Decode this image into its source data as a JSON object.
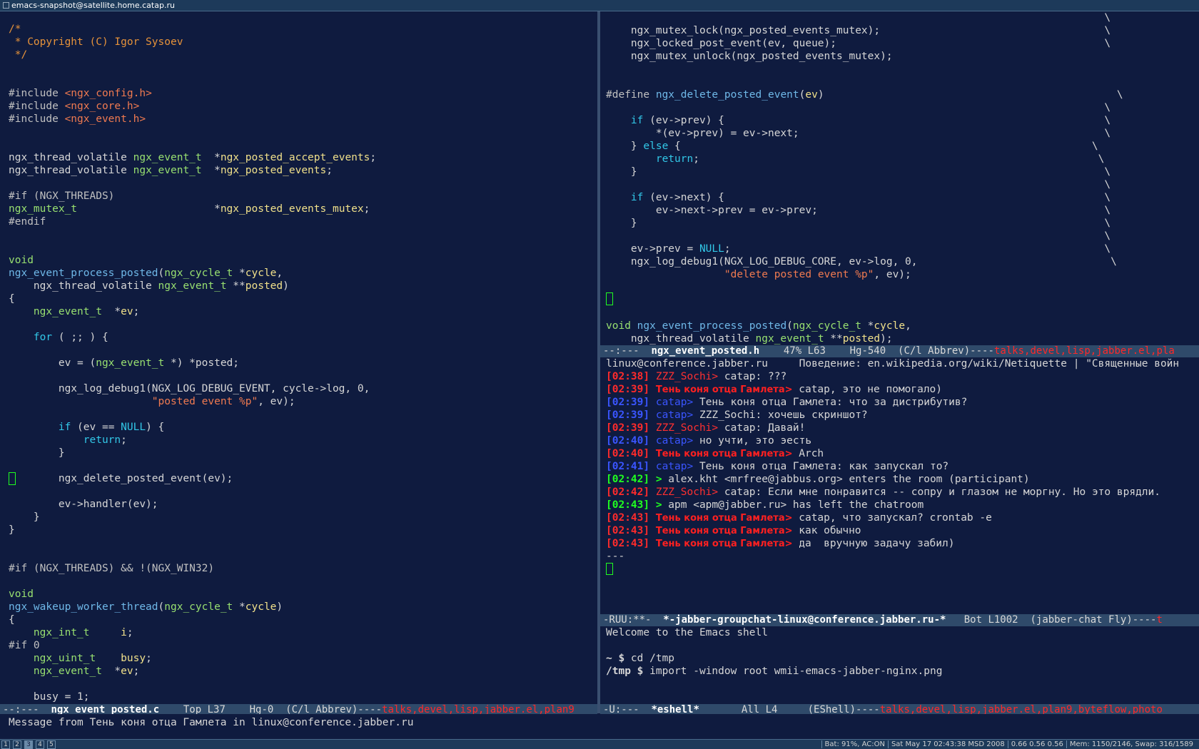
{
  "window_title": "emacs-snapshot@satellite.home.catap.ru",
  "left_buffer": {
    "lines": [
      [
        {
          "t": "/*",
          "c": "comment"
        }
      ],
      [
        {
          "t": " * Copyright (C) Igor Sysoev",
          "c": "comment"
        }
      ],
      [
        {
          "t": " */",
          "c": "comment"
        }
      ],
      [],
      [],
      [
        {
          "t": "#include ",
          "c": "def"
        },
        {
          "t": "<ngx_config.h>",
          "c": "str"
        }
      ],
      [
        {
          "t": "#include ",
          "c": "def"
        },
        {
          "t": "<ngx_core.h>",
          "c": "str"
        }
      ],
      [
        {
          "t": "#include ",
          "c": "def"
        },
        {
          "t": "<ngx_event.h>",
          "c": "str"
        }
      ],
      [],
      [],
      [
        {
          "t": "ngx_thread_volatile ",
          "c": "plain"
        },
        {
          "t": "ngx_event_t",
          "c": "type"
        },
        {
          "t": "  *",
          "c": "plain"
        },
        {
          "t": "ngx_posted_accept_events",
          "c": "var"
        },
        {
          "t": ";",
          "c": "plain"
        }
      ],
      [
        {
          "t": "ngx_thread_volatile ",
          "c": "plain"
        },
        {
          "t": "ngx_event_t",
          "c": "type"
        },
        {
          "t": "  *",
          "c": "plain"
        },
        {
          "t": "ngx_posted_events",
          "c": "var"
        },
        {
          "t": ";",
          "c": "plain"
        }
      ],
      [],
      [
        {
          "t": "#if (NGX_THREADS)",
          "c": "def"
        }
      ],
      [
        {
          "t": "ngx_mutex_t",
          "c": "type"
        },
        {
          "t": "                      *",
          "c": "plain"
        },
        {
          "t": "ngx_posted_events_mutex",
          "c": "var"
        },
        {
          "t": ";",
          "c": "plain"
        }
      ],
      [
        {
          "t": "#endif",
          "c": "def"
        }
      ],
      [],
      [],
      [
        {
          "t": "void",
          "c": "type"
        }
      ],
      [
        {
          "t": "ngx_event_process_posted",
          "c": "func"
        },
        {
          "t": "(",
          "c": "plain"
        },
        {
          "t": "ngx_cycle_t",
          "c": "type"
        },
        {
          "t": " *",
          "c": "plain"
        },
        {
          "t": "cycle",
          "c": "var"
        },
        {
          "t": ",",
          "c": "plain"
        }
      ],
      [
        {
          "t": "    ngx_thread_volatile ",
          "c": "plain"
        },
        {
          "t": "ngx_event_t",
          "c": "type"
        },
        {
          "t": " **",
          "c": "plain"
        },
        {
          "t": "posted",
          "c": "var"
        },
        {
          "t": ")",
          "c": "plain"
        }
      ],
      [
        {
          "t": "{",
          "c": "plain"
        }
      ],
      [
        {
          "t": "    ",
          "c": "plain"
        },
        {
          "t": "ngx_event_t",
          "c": "type"
        },
        {
          "t": "  *",
          "c": "plain"
        },
        {
          "t": "ev",
          "c": "var"
        },
        {
          "t": ";",
          "c": "plain"
        }
      ],
      [],
      [
        {
          "t": "    ",
          "c": "plain"
        },
        {
          "t": "for",
          "c": "kw"
        },
        {
          "t": " ( ;; ) {",
          "c": "plain"
        }
      ],
      [],
      [
        {
          "t": "        ev = (",
          "c": "plain"
        },
        {
          "t": "ngx_event_t",
          "c": "type"
        },
        {
          "t": " *) *posted;",
          "c": "plain"
        }
      ],
      [],
      [
        {
          "t": "        ngx_log_debug1(NGX_LOG_DEBUG_EVENT, cycle->log, 0,",
          "c": "plain"
        }
      ],
      [
        {
          "t": "                       ",
          "c": "plain"
        },
        {
          "t": "\"posted event %p\"",
          "c": "str"
        },
        {
          "t": ", ev);",
          "c": "plain"
        }
      ],
      [],
      [
        {
          "t": "        ",
          "c": "plain"
        },
        {
          "t": "if",
          "c": "kw"
        },
        {
          "t": " (ev == ",
          "c": "plain"
        },
        {
          "t": "NULL",
          "c": "kw"
        },
        {
          "t": ") {",
          "c": "plain"
        }
      ],
      [
        {
          "t": "            ",
          "c": "plain"
        },
        {
          "t": "return",
          "c": "kw"
        },
        {
          "t": ";",
          "c": "plain"
        }
      ],
      [
        {
          "t": "        }",
          "c": "plain"
        }
      ],
      [],
      [
        {
          "t": "        ngx_delete_posted_event(ev);",
          "c": "plain"
        }
      ],
      [],
      [
        {
          "t": "        ev->handler(ev);",
          "c": "plain"
        }
      ],
      [
        {
          "t": "    }",
          "c": "plain"
        }
      ],
      [
        {
          "t": "}",
          "c": "plain"
        }
      ],
      [],
      [],
      [
        {
          "t": "#if (NGX_THREADS) && !(NGX_WIN32)",
          "c": "def"
        }
      ],
      [],
      [
        {
          "t": "void",
          "c": "type"
        }
      ],
      [
        {
          "t": "ngx_wakeup_worker_thread",
          "c": "func"
        },
        {
          "t": "(",
          "c": "plain"
        },
        {
          "t": "ngx_cycle_t",
          "c": "type"
        },
        {
          "t": " *",
          "c": "plain"
        },
        {
          "t": "cycle",
          "c": "var"
        },
        {
          "t": ")",
          "c": "plain"
        }
      ],
      [
        {
          "t": "{",
          "c": "plain"
        }
      ],
      [
        {
          "t": "    ",
          "c": "plain"
        },
        {
          "t": "ngx_int_t",
          "c": "type"
        },
        {
          "t": "     ",
          "c": "plain"
        },
        {
          "t": "i",
          "c": "var"
        },
        {
          "t": ";",
          "c": "plain"
        }
      ],
      [
        {
          "t": "#if 0",
          "c": "def"
        }
      ],
      [
        {
          "t": "    ",
          "c": "plain"
        },
        {
          "t": "ngx_uint_t",
          "c": "type"
        },
        {
          "t": "    ",
          "c": "plain"
        },
        {
          "t": "busy",
          "c": "var"
        },
        {
          "t": ";",
          "c": "plain"
        }
      ],
      [
        {
          "t": "    ",
          "c": "plain"
        },
        {
          "t": "ngx_event_t",
          "c": "type"
        },
        {
          "t": "  *",
          "c": "plain"
        },
        {
          "t": "ev",
          "c": "var"
        },
        {
          "t": ";",
          "c": "plain"
        }
      ],
      [],
      [
        {
          "t": "    busy = 1;",
          "c": "plain"
        }
      ]
    ],
    "modeline": {
      "prefix": "--:---  ",
      "filename": "ngx_event_posted.c",
      "info": "    Top L37    Hg-0  (C/l Abbrev)----",
      "projects": "talks,devel,lisp,jabber.el,plan9"
    }
  },
  "right_top_buffer": {
    "lines": [
      [
        {
          "t": "                                                                                \\",
          "c": "plain"
        }
      ],
      [
        {
          "t": "    ngx_mutex_lock(ngx_posted_events_mutex);                                    \\",
          "c": "plain"
        }
      ],
      [
        {
          "t": "    ngx_locked_post_event(ev, queue);                                           \\",
          "c": "plain"
        }
      ],
      [
        {
          "t": "    ngx_mutex_unlock(ngx_posted_events_mutex);",
          "c": "plain"
        }
      ],
      [],
      [],
      [
        {
          "t": "#define ",
          "c": "def"
        },
        {
          "t": "ngx_delete_posted_event",
          "c": "func"
        },
        {
          "t": "(",
          "c": "plain"
        },
        {
          "t": "ev",
          "c": "var"
        },
        {
          "t": ")                                               \\",
          "c": "plain"
        }
      ],
      [
        {
          "t": "                                                                                \\",
          "c": "plain"
        }
      ],
      [
        {
          "t": "    ",
          "c": "plain"
        },
        {
          "t": "if",
          "c": "kw"
        },
        {
          "t": " (ev->prev) {                                                             \\",
          "c": "plain"
        }
      ],
      [
        {
          "t": "        *(ev->prev) = ev->next;                                                 \\",
          "c": "plain"
        }
      ],
      [
        {
          "t": "    } ",
          "c": "plain"
        },
        {
          "t": "else",
          "c": "kw"
        },
        {
          "t": " {                                                                  \\",
          "c": "plain"
        }
      ],
      [
        {
          "t": "        ",
          "c": "plain"
        },
        {
          "t": "return",
          "c": "kw"
        },
        {
          "t": ";                                                                \\",
          "c": "plain"
        }
      ],
      [
        {
          "t": "    }                                                                           \\",
          "c": "plain"
        }
      ],
      [
        {
          "t": "                                                                                \\",
          "c": "plain"
        }
      ],
      [
        {
          "t": "    ",
          "c": "plain"
        },
        {
          "t": "if",
          "c": "kw"
        },
        {
          "t": " (ev->next) {                                                             \\",
          "c": "plain"
        }
      ],
      [
        {
          "t": "        ev->next->prev = ev->prev;                                              \\",
          "c": "plain"
        }
      ],
      [
        {
          "t": "    }                                                                           \\",
          "c": "plain"
        }
      ],
      [
        {
          "t": "                                                                                \\",
          "c": "plain"
        }
      ],
      [
        {
          "t": "    ev->prev = ",
          "c": "plain"
        },
        {
          "t": "NULL",
          "c": "kw"
        },
        {
          "t": ";                                                            \\",
          "c": "plain"
        }
      ],
      [
        {
          "t": "    ngx_log_debug1(NGX_LOG_DEBUG_CORE, ev->log, 0,                               \\",
          "c": "plain"
        }
      ],
      [
        {
          "t": "                   ",
          "c": "plain"
        },
        {
          "t": "\"delete posted event %p\"",
          "c": "str"
        },
        {
          "t": ", ev);",
          "c": "plain"
        }
      ],
      [],
      [],
      [],
      [
        {
          "t": "void ",
          "c": "type"
        },
        {
          "t": "ngx_event_process_posted",
          "c": "func"
        },
        {
          "t": "(",
          "c": "plain"
        },
        {
          "t": "ngx_cycle_t",
          "c": "type"
        },
        {
          "t": " *",
          "c": "plain"
        },
        {
          "t": "cycle",
          "c": "var"
        },
        {
          "t": ",",
          "c": "plain"
        }
      ],
      [
        {
          "t": "    ngx_thread_volatile ",
          "c": "plain"
        },
        {
          "t": "ngx_event_t",
          "c": "type"
        },
        {
          "t": " **",
          "c": "plain"
        },
        {
          "t": "posted",
          "c": "var"
        },
        {
          "t": ");",
          "c": "plain"
        }
      ]
    ],
    "modeline": {
      "prefix": "--:---  ",
      "filename": "ngx_event_posted.h",
      "info": "    47% L63    Hg-540  (C/l Abbrev)----",
      "projects": "talks,devel,lisp,jabber.el,pla"
    }
  },
  "chat_buffer": {
    "header": "linux@conference.jabber.ru     Поведение: en.wikipedia.org/wiki/Netiquette | \"Священные войн",
    "messages": [
      {
        "time": "[02:38]",
        "time_c": "red",
        "nick": "ZZZ_Sochi>",
        "nick_c": "nick-red",
        "text": " catap: ???"
      },
      {
        "time": "[02:39]",
        "time_c": "red",
        "nick": "Тень коня отца Гамлета>",
        "nick_c": "nick-redb",
        "text": " catap, это не помогало)"
      },
      {
        "time": "[02:39]",
        "time_c": "nick-blue",
        "nick": "catap>",
        "nick_c": "nick-blue",
        "text": " Тень коня отца Гамлета: что за дистрибутив?"
      },
      {
        "time": "[02:39]",
        "time_c": "nick-blue",
        "nick": "catap>",
        "nick_c": "nick-blue",
        "text": " ZZZ_Sochi: хочешь скриншот?"
      },
      {
        "time": "[02:39]",
        "time_c": "red",
        "nick": "ZZZ_Sochi>",
        "nick_c": "nick-red",
        "text": " catap: Давай!"
      },
      {
        "time": "[02:40]",
        "time_c": "nick-blue",
        "nick": "catap>",
        "nick_c": "nick-blue",
        "text": " но учти, это эесть"
      },
      {
        "time": "[02:40]",
        "time_c": "red",
        "nick": "Тень коня отца Гамлета>",
        "nick_c": "nick-redb",
        "text": " Arch"
      },
      {
        "time": "[02:41]",
        "time_c": "nick-blue",
        "nick": "catap>",
        "nick_c": "nick-blue",
        "text": " Тень коня отца Гамлета: как запускал то?"
      },
      {
        "time": "[02:42]",
        "time_c": "green",
        "nick": ">",
        "nick_c": "green",
        "text": " alex.kht <mrfree@jabbus.org> enters the room (participant)"
      },
      {
        "time": "[02:42]",
        "time_c": "red",
        "nick": "ZZZ_Sochi>",
        "nick_c": "nick-red",
        "text": " catap: Если мне понравится -- сопру и глазом не моргну. Но это врядли."
      },
      {
        "time": "[02:43]",
        "time_c": "green",
        "nick": ">",
        "nick_c": "green",
        "text": " apm <apm@jabber.ru> has left the chatroom"
      },
      {
        "time": "[02:43]",
        "time_c": "red",
        "nick": "Тень коня отца Гамлета>",
        "nick_c": "nick-redb",
        "text": " catap, что запускал? crontab -e"
      },
      {
        "time": "[02:43]",
        "time_c": "red",
        "nick": "Тень коня отца Гамлета>",
        "nick_c": "nick-redb",
        "text": " как обычно"
      },
      {
        "time": "[02:43]",
        "time_c": "red",
        "nick": "Тень коня отца Гамлета>",
        "nick_c": "nick-redb",
        "text": " да  вручную задачу забил)"
      }
    ],
    "separator": "---",
    "modeline": {
      "prefix": "-RUU:**-  ",
      "filename": "*-jabber-groupchat-linux@conference.jabber.ru-*",
      "info": "   Bot L1002  (jabber-chat Fly)----",
      "projects": "t"
    }
  },
  "eshell_buffer": {
    "welcome": "Welcome to the Emacs shell",
    "commands": [
      {
        "prompt": "~ $",
        "cmd": " cd /tmp"
      },
      {
        "prompt": "/tmp $",
        "cmd": " import -window root wmii-emacs-jabber-nginx.png"
      }
    ],
    "modeline": {
      "prefix": "-U:---  ",
      "filename": "*eshell*",
      "info": "       All L4     (EShell)----",
      "projects": "talks,devel,lisp,jabber.el,plan9,byteflow,photo"
    }
  },
  "echo_area": "Message from Тень коня отца Гамлета in linux@conference.jabber.ru",
  "status_bar": {
    "tags": [
      "1",
      "2",
      "3",
      "4",
      "5"
    ],
    "active_tag": "3",
    "battery": "Bat: 91%, AC:ON",
    "datetime": "Sat May 17 02:43:38 MSD 2008",
    "load": "0.66 0.56 0.56",
    "memory": "Mem: 1150/2146, Swap: 316/1589"
  },
  "colors": {
    "background": "#0f1b3f",
    "modeline": "#2f4a6a",
    "comment": "#e6923a",
    "string": "#f07a50",
    "type": "#98e070",
    "function": "#6fb8e8",
    "variable": "#f0e08a",
    "keyword": "#32c8e8",
    "cursor": "#20ff20"
  }
}
